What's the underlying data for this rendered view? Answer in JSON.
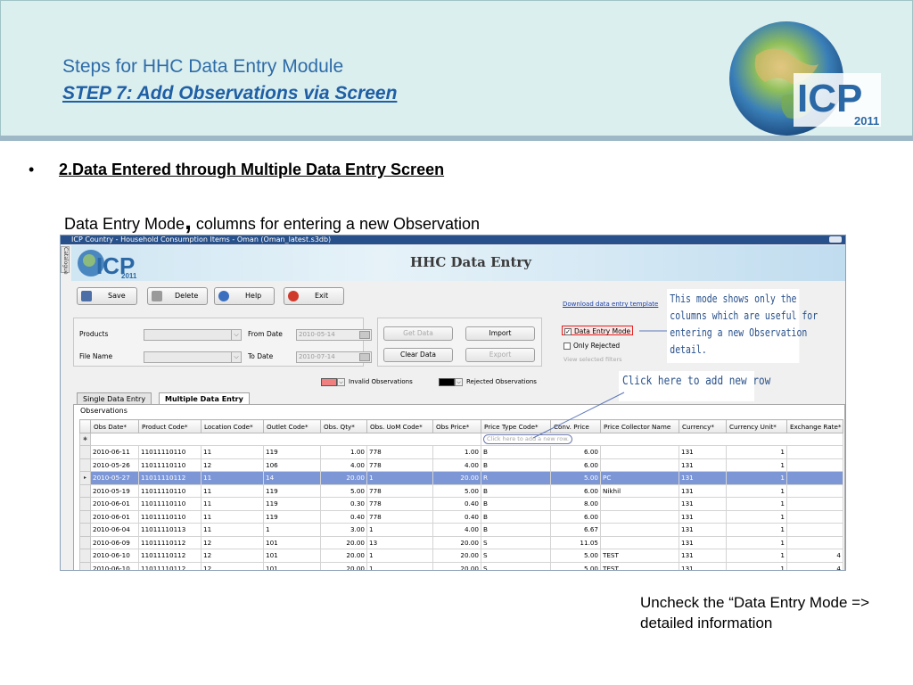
{
  "slide": {
    "title": "Steps for HHC Data Entry Module",
    "subtitle": "STEP 7: Add Observations via  Screen",
    "bullet_symbol": "•",
    "step_heading": "2.Data Entered through Multiple Data Entry Screen",
    "mode_line_a": "Data Entry Mode",
    "mode_line_comma": ",",
    "mode_line_b": " columns for entering a new Observation",
    "bottom_note": "Uncheck the “Data Entry Mode => detailed information",
    "logo_text": "ICP",
    "logo_year": "2011"
  },
  "callouts": {
    "mode_note": "This mode shows only the columns which are useful for entering a new Observation detail.",
    "add_row_note": "Click here to add new row"
  },
  "app": {
    "window_title": "ICP Country - Household Consumption Items - Oman (Oman_latest.s3db)",
    "side_tab": "Catalogue",
    "banner_title": "HHC Data Entry",
    "toolbar": {
      "save": "Save",
      "delete": "Delete",
      "help": "Help",
      "exit": "Exit"
    },
    "download_link": "Download data entry template",
    "filters": {
      "products_label": "Products",
      "file_name_label": "File Name",
      "from_date_label": "From Date",
      "to_date_label": "To Date",
      "from_date_value": "2010-05-14",
      "to_date_value": "2010-07-14"
    },
    "buttons": {
      "get_data": "Get Data",
      "import": "Import",
      "clear_data": "Clear Data",
      "export": "Export"
    },
    "mode": {
      "data_entry_mode": "Data Entry Mode",
      "only_rejected": "Only Rejected",
      "view_filters": "View selected filters"
    },
    "legend": {
      "invalid": "Invalid Observations",
      "rejected": "Rejected Observations",
      "invalid_color": "#f08080",
      "rejected_color": "#000000"
    },
    "tabs": [
      "Single Data Entry",
      "Multiple Data Entry"
    ],
    "observations_label": "Observations",
    "add_row_hint": "Click here to add a new row.",
    "columns": [
      "Obs Date*",
      "Product Code*",
      "Location Code*",
      "Outlet Code*",
      "Obs. Qty*",
      "Obs. UoM Code*",
      "Obs Price*",
      "Price Type Code*",
      "Conv. Price",
      "Price Collector Name",
      "Currency*",
      "Currency Unit*",
      "Exchange Rate*"
    ],
    "rows": [
      [
        "2010-06-11",
        "11011110110",
        "11",
        "119",
        "1.00",
        "778",
        "1.00",
        "B",
        "6.00",
        "",
        "131",
        "1",
        ""
      ],
      [
        "2010-05-26",
        "11011110110",
        "12",
        "106",
        "4.00",
        "778",
        "4.00",
        "B",
        "6.00",
        "",
        "131",
        "1",
        ""
      ],
      [
        "2010-05-27",
        "11011110112",
        "11",
        "14",
        "20.00",
        "1",
        "20.00",
        "R",
        "5.00",
        "PC",
        "131",
        "1",
        ""
      ],
      [
        "2010-05-19",
        "11011110110",
        "11",
        "119",
        "5.00",
        "778",
        "5.00",
        "B",
        "6.00",
        "Nikhil",
        "131",
        "1",
        ""
      ],
      [
        "2010-06-01",
        "11011110110",
        "11",
        "119",
        "0.30",
        "778",
        "0.40",
        "B",
        "8.00",
        "",
        "131",
        "1",
        ""
      ],
      [
        "2010-06-01",
        "11011110110",
        "11",
        "119",
        "0.40",
        "778",
        "0.40",
        "B",
        "6.00",
        "",
        "131",
        "1",
        ""
      ],
      [
        "2010-06-04",
        "11011110113",
        "11",
        "1",
        "3.00",
        "1",
        "4.00",
        "B",
        "6.67",
        "",
        "131",
        "1",
        ""
      ],
      [
        "2010-06-09",
        "11011110112",
        "12",
        "101",
        "20.00",
        "13",
        "20.00",
        "S",
        "11.05",
        "",
        "131",
        "1",
        ""
      ],
      [
        "2010-06-10",
        "11011110112",
        "12",
        "101",
        "20.00",
        "1",
        "20.00",
        "S",
        "5.00",
        "TEST",
        "131",
        "1",
        "4"
      ],
      [
        "2010-06-10",
        "11011110112",
        "12",
        "101",
        "20.00",
        "1",
        "20.00",
        "S",
        "5.00",
        "TEST",
        "131",
        "1",
        "4"
      ]
    ],
    "selected_row_index": 2,
    "colors": {
      "title_bar": "#28508a",
      "selected_row": "#7d96d6",
      "slide_title": "#2e6ca8",
      "callout_text": "#28508a"
    }
  }
}
